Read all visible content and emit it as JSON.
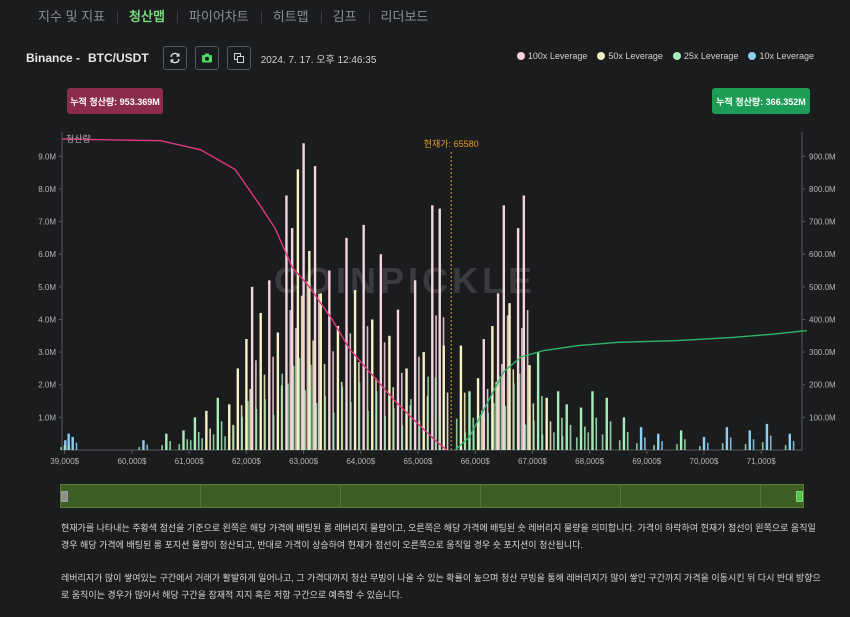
{
  "tabs": [
    "지수 및 지표",
    "청산맵",
    "파이어차트",
    "히트맵",
    "김프",
    "리더보드"
  ],
  "active_tab": 1,
  "toolbar": {
    "exchange": "Binance -",
    "pair": "BTC/USDT",
    "datetime": "2024. 7. 17. 오후 12:46:35",
    "refresh_icon": "refresh-icon",
    "camera_icon": "camera-icon",
    "copy_icon": "copy-icon"
  },
  "legend": [
    {
      "label": "100x Leverage",
      "color": "#f6d6dc"
    },
    {
      "label": "50x Leverage",
      "color": "#f7f2c4"
    },
    {
      "label": "25x Leverage",
      "color": "#a6ecb8"
    },
    {
      "label": "10x Leverage",
      "color": "#8ccff2"
    }
  ],
  "badges": {
    "left": "누적 청산량: 953.369M",
    "right": "누적 청산량: 366.352M",
    "left_color": "#8b2c4e",
    "right_color": "#1d9c55"
  },
  "chart_data": {
    "type": "bar",
    "title": "",
    "left_axis_title": "청산량",
    "current_price_label": "현재가: 65580",
    "current_price": 65580,
    "watermark": "COINPICKLE",
    "x_range": [
      38800,
      71800
    ],
    "x_ticks": [
      "39,000$",
      "60,000$",
      "61,000$",
      "62,000$",
      "63,000$",
      "64,000$",
      "65,000$",
      "66,000$",
      "67,000$",
      "68,000$",
      "69,000$",
      "70,000$",
      "71,000$"
    ],
    "y_left_ticks": [
      "1.0M",
      "2.0M",
      "3.0M",
      "4.0M",
      "5.0M",
      "6.0M",
      "7.0M",
      "8.0M",
      "9.0M"
    ],
    "y_left_range": [
      0,
      9500000
    ],
    "y_right_ticks": [
      "100.0M",
      "200.0M",
      "300.0M",
      "400.0M",
      "500.0M",
      "600.0M",
      "700.0M",
      "800.0M",
      "900.0M"
    ],
    "y_right_range": [
      0,
      950000000
    ],
    "cumulative_short_line": {
      "color": "#e0367f",
      "points": [
        [
          38800,
          953
        ],
        [
          60500,
          948
        ],
        [
          61200,
          920
        ],
        [
          61800,
          860
        ],
        [
          62200,
          760
        ],
        [
          62500,
          680
        ],
        [
          62800,
          560
        ],
        [
          63100,
          500
        ],
        [
          63500,
          400
        ],
        [
          63800,
          310
        ],
        [
          64200,
          230
        ],
        [
          64600,
          150
        ],
        [
          65000,
          80
        ],
        [
          65300,
          30
        ],
        [
          65500,
          0
        ]
      ]
    },
    "cumulative_long_line": {
      "color": "#2fb56a",
      "points": [
        [
          65650,
          0
        ],
        [
          65900,
          40
        ],
        [
          66200,
          140
        ],
        [
          66500,
          240
        ],
        [
          66800,
          285
        ],
        [
          67200,
          305
        ],
        [
          67800,
          320
        ],
        [
          68500,
          330
        ],
        [
          69500,
          335
        ],
        [
          70500,
          345
        ],
        [
          71200,
          355
        ],
        [
          71800,
          366
        ]
      ]
    },
    "bars": [
      {
        "price": 39050,
        "value": 0.3,
        "leverage": "10x"
      },
      {
        "price": 39300,
        "value": 0.5,
        "leverage": "10x"
      },
      {
        "price": 39600,
        "value": 0.4,
        "leverage": "10x"
      },
      {
        "price": 60200,
        "value": 0.3,
        "leverage": "10x"
      },
      {
        "price": 60600,
        "value": 0.5,
        "leverage": "25x"
      },
      {
        "price": 60900,
        "value": 0.6,
        "leverage": "25x"
      },
      {
        "price": 61100,
        "value": 1.0,
        "leverage": "25x"
      },
      {
        "price": 61300,
        "value": 1.2,
        "leverage": "50x"
      },
      {
        "price": 61500,
        "value": 1.6,
        "leverage": "25x"
      },
      {
        "price": 61700,
        "value": 1.4,
        "leverage": "50x"
      },
      {
        "price": 61850,
        "value": 2.5,
        "leverage": "50x"
      },
      {
        "price": 62000,
        "value": 3.4,
        "leverage": "50x"
      },
      {
        "price": 62100,
        "value": 5.0,
        "leverage": "100x"
      },
      {
        "price": 62250,
        "value": 4.2,
        "leverage": "50x"
      },
      {
        "price": 62400,
        "value": 5.2,
        "leverage": "100x"
      },
      {
        "price": 62550,
        "value": 3.6,
        "leverage": "50x"
      },
      {
        "price": 62700,
        "value": 7.8,
        "leverage": "100x"
      },
      {
        "price": 62800,
        "value": 6.8,
        "leverage": "100x"
      },
      {
        "price": 62900,
        "value": 8.6,
        "leverage": "50x"
      },
      {
        "price": 63000,
        "value": 9.4,
        "leverage": "100x"
      },
      {
        "price": 63100,
        "value": 6.1,
        "leverage": "50x"
      },
      {
        "price": 63200,
        "value": 8.7,
        "leverage": "100x"
      },
      {
        "price": 63300,
        "value": 4.8,
        "leverage": "50x"
      },
      {
        "price": 63450,
        "value": 5.5,
        "leverage": "100x"
      },
      {
        "price": 63600,
        "value": 3.8,
        "leverage": "50x"
      },
      {
        "price": 63750,
        "value": 6.5,
        "leverage": "100x"
      },
      {
        "price": 63900,
        "value": 4.9,
        "leverage": "50x"
      },
      {
        "price": 64050,
        "value": 6.9,
        "leverage": "100x"
      },
      {
        "price": 64200,
        "value": 4.0,
        "leverage": "50x"
      },
      {
        "price": 64350,
        "value": 6.0,
        "leverage": "100x"
      },
      {
        "price": 64500,
        "value": 3.5,
        "leverage": "50x"
      },
      {
        "price": 64650,
        "value": 4.3,
        "leverage": "100x"
      },
      {
        "price": 64800,
        "value": 2.5,
        "leverage": "50x"
      },
      {
        "price": 64950,
        "value": 5.2,
        "leverage": "100x"
      },
      {
        "price": 65100,
        "value": 3.0,
        "leverage": "50x"
      },
      {
        "price": 65250,
        "value": 7.5,
        "leverage": "100x"
      },
      {
        "price": 65380,
        "value": 7.4,
        "leverage": "100x"
      },
      {
        "price": 65450,
        "value": 3.2,
        "leverage": "50x"
      },
      {
        "price": 65750,
        "value": 3.2,
        "leverage": "50x"
      },
      {
        "price": 65900,
        "value": 1.8,
        "leverage": "25x"
      },
      {
        "price": 66050,
        "value": 2.2,
        "leverage": "50x"
      },
      {
        "price": 66150,
        "value": 3.4,
        "leverage": "100x"
      },
      {
        "price": 66300,
        "value": 3.8,
        "leverage": "50x"
      },
      {
        "price": 66400,
        "value": 4.8,
        "leverage": "100x"
      },
      {
        "price": 66500,
        "value": 7.5,
        "leverage": "100x"
      },
      {
        "price": 66600,
        "value": 4.5,
        "leverage": "50x"
      },
      {
        "price": 66750,
        "value": 6.8,
        "leverage": "100x"
      },
      {
        "price": 66850,
        "value": 7.8,
        "leverage": "100x"
      },
      {
        "price": 66950,
        "value": 2.6,
        "leverage": "50x"
      },
      {
        "price": 67100,
        "value": 3.0,
        "leverage": "25x"
      },
      {
        "price": 67250,
        "value": 1.6,
        "leverage": "50x"
      },
      {
        "price": 67450,
        "value": 1.8,
        "leverage": "25x"
      },
      {
        "price": 67600,
        "value": 1.4,
        "leverage": "25x"
      },
      {
        "price": 67850,
        "value": 1.3,
        "leverage": "25x"
      },
      {
        "price": 68050,
        "value": 1.8,
        "leverage": "25x"
      },
      {
        "price": 68300,
        "value": 1.6,
        "leverage": "25x"
      },
      {
        "price": 68600,
        "value": 1.0,
        "leverage": "25x"
      },
      {
        "price": 68900,
        "value": 0.7,
        "leverage": "10x"
      },
      {
        "price": 69200,
        "value": 0.5,
        "leverage": "10x"
      },
      {
        "price": 69600,
        "value": 0.6,
        "leverage": "25x"
      },
      {
        "price": 70000,
        "value": 0.4,
        "leverage": "10x"
      },
      {
        "price": 70400,
        "value": 0.7,
        "leverage": "10x"
      },
      {
        "price": 70800,
        "value": 0.6,
        "leverage": "10x"
      },
      {
        "price": 71100,
        "value": 0.8,
        "leverage": "10x"
      },
      {
        "price": 71500,
        "value": 0.5,
        "leverage": "10x"
      }
    ]
  },
  "description": {
    "para1": "현재가를 나타내는 주황색 점선을 기준으로 왼쪽은 해당 가격에 배팅된 롱 레버리지 물량이고, 오른쪽은 해당 가격에 배팅된 숏 레버리지 물량을 의미합니다. 가격이 하락하여 현재가 점선이 왼쪽으로 움직일 경우 해당 가격에 배팅된 롱 포지션 물량이 청산되고, 반대로 가격이 상승하여 현재가 점선이 오른쪽으로 움직일 경우 숏 포지션이 청산됩니다.",
    "para2": "레버리지가 많이 쌓여있는 구간에서 거래가 활발하게 일어나고, 그 가격대까지 청산 무빙이 나올 수 있는 확률이 높으며 청산 무빙을 통해 레버리지가 많이 쌓인 구간까지 가격을 이동시킨 뒤 다시 반대 방향으로 움직이는 경우가 많아서 해당 구간을 잠재적 지지 혹은 저항 구간으로 예측할 수 있습니다."
  }
}
